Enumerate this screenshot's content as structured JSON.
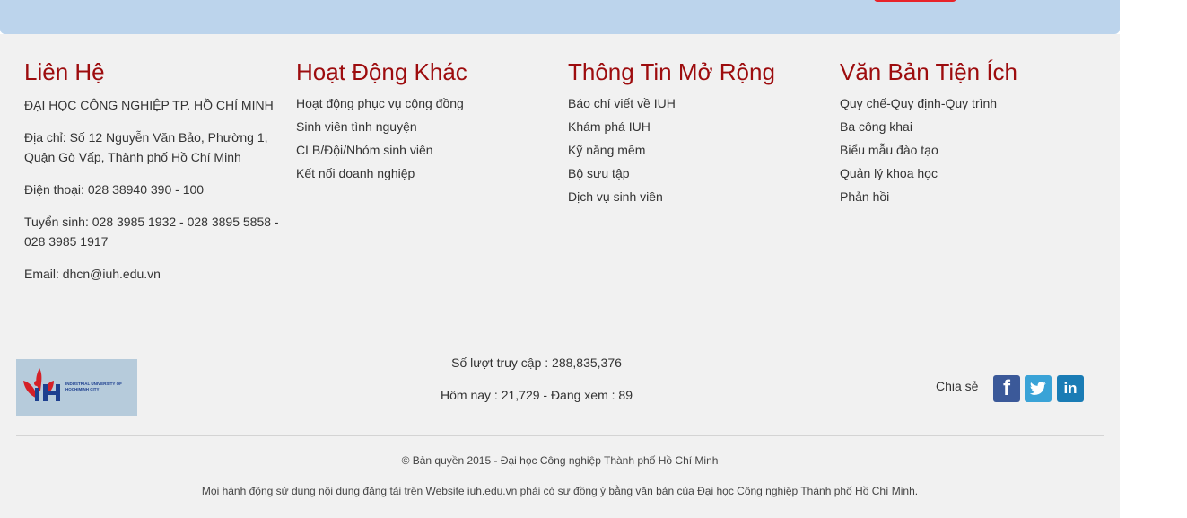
{
  "colors": {
    "top_band": "#bcd4ec",
    "footer_bg": "#f1f1f1",
    "heading": "#9d0c0e",
    "facebook": "#3b5999",
    "twitter": "#3aa3d7",
    "linkedin": "#1a7cb5"
  },
  "contact": {
    "heading": "Liên Hệ",
    "org": "ĐẠI HỌC CÔNG NGHIỆP TP. HỒ CHÍ MINH",
    "address": "Địa chỉ: Số 12 Nguyễn Văn Bảo, Phường 1, Quận Gò Vấp, Thành phố Hồ Chí Minh",
    "phone": "Điện thoại: 028 38940 390 - 100",
    "admission": "Tuyển sinh: 028 3985 1932 - 028 3895 5858 - 028 3985 1917",
    "email": "Email: dhcn@iuh.edu.vn"
  },
  "other_activities": {
    "heading": "Hoạt Động Khác",
    "items": [
      "Hoạt động phục vụ cộng đồng",
      "Sinh viên tình nguyện",
      "CLB/Đội/Nhóm sinh viên",
      "Kết nối doanh nghiệp"
    ]
  },
  "extended_info": {
    "heading": "Thông Tin Mở Rộng",
    "items": [
      "Báo chí viết về IUH",
      "Khám phá IUH",
      "Kỹ năng mềm",
      "Bộ sưu tập",
      "Dịch vụ sinh viên"
    ]
  },
  "documents": {
    "heading": "Văn Bản Tiện Ích",
    "items": [
      "Quy chế-Quy định-Quy trình",
      "Ba công khai",
      "Biểu mẫu đào tạo",
      "Quản lý khoa học",
      "Phản hồi"
    ]
  },
  "logo": {
    "icon": "iuh-logo-icon",
    "text": "INDUSTRIAL UNIVERSITY OF HOCHIMINH CITY"
  },
  "stats": {
    "total_visits": "Số lượt truy cập : 288,835,376",
    "today": "Hôm nay : 21,729 - Đang xem : 89"
  },
  "share": {
    "label": "Chia sẻ",
    "icons": [
      "facebook-icon",
      "twitter-icon",
      "linkedin-icon"
    ],
    "facebook_glyph": "f",
    "linkedin_glyph": "in"
  },
  "copyright": {
    "line1": "© Bản quyền 2015 - Đại học Công nghiệp Thành phố Hồ Chí Minh",
    "line2": "Mọi hành động sử dụng nội dung đăng tải trên Website iuh.edu.vn phải có sự đồng ý bằng văn bản của Đại học Công nghiệp Thành phố Hồ Chí Minh."
  }
}
